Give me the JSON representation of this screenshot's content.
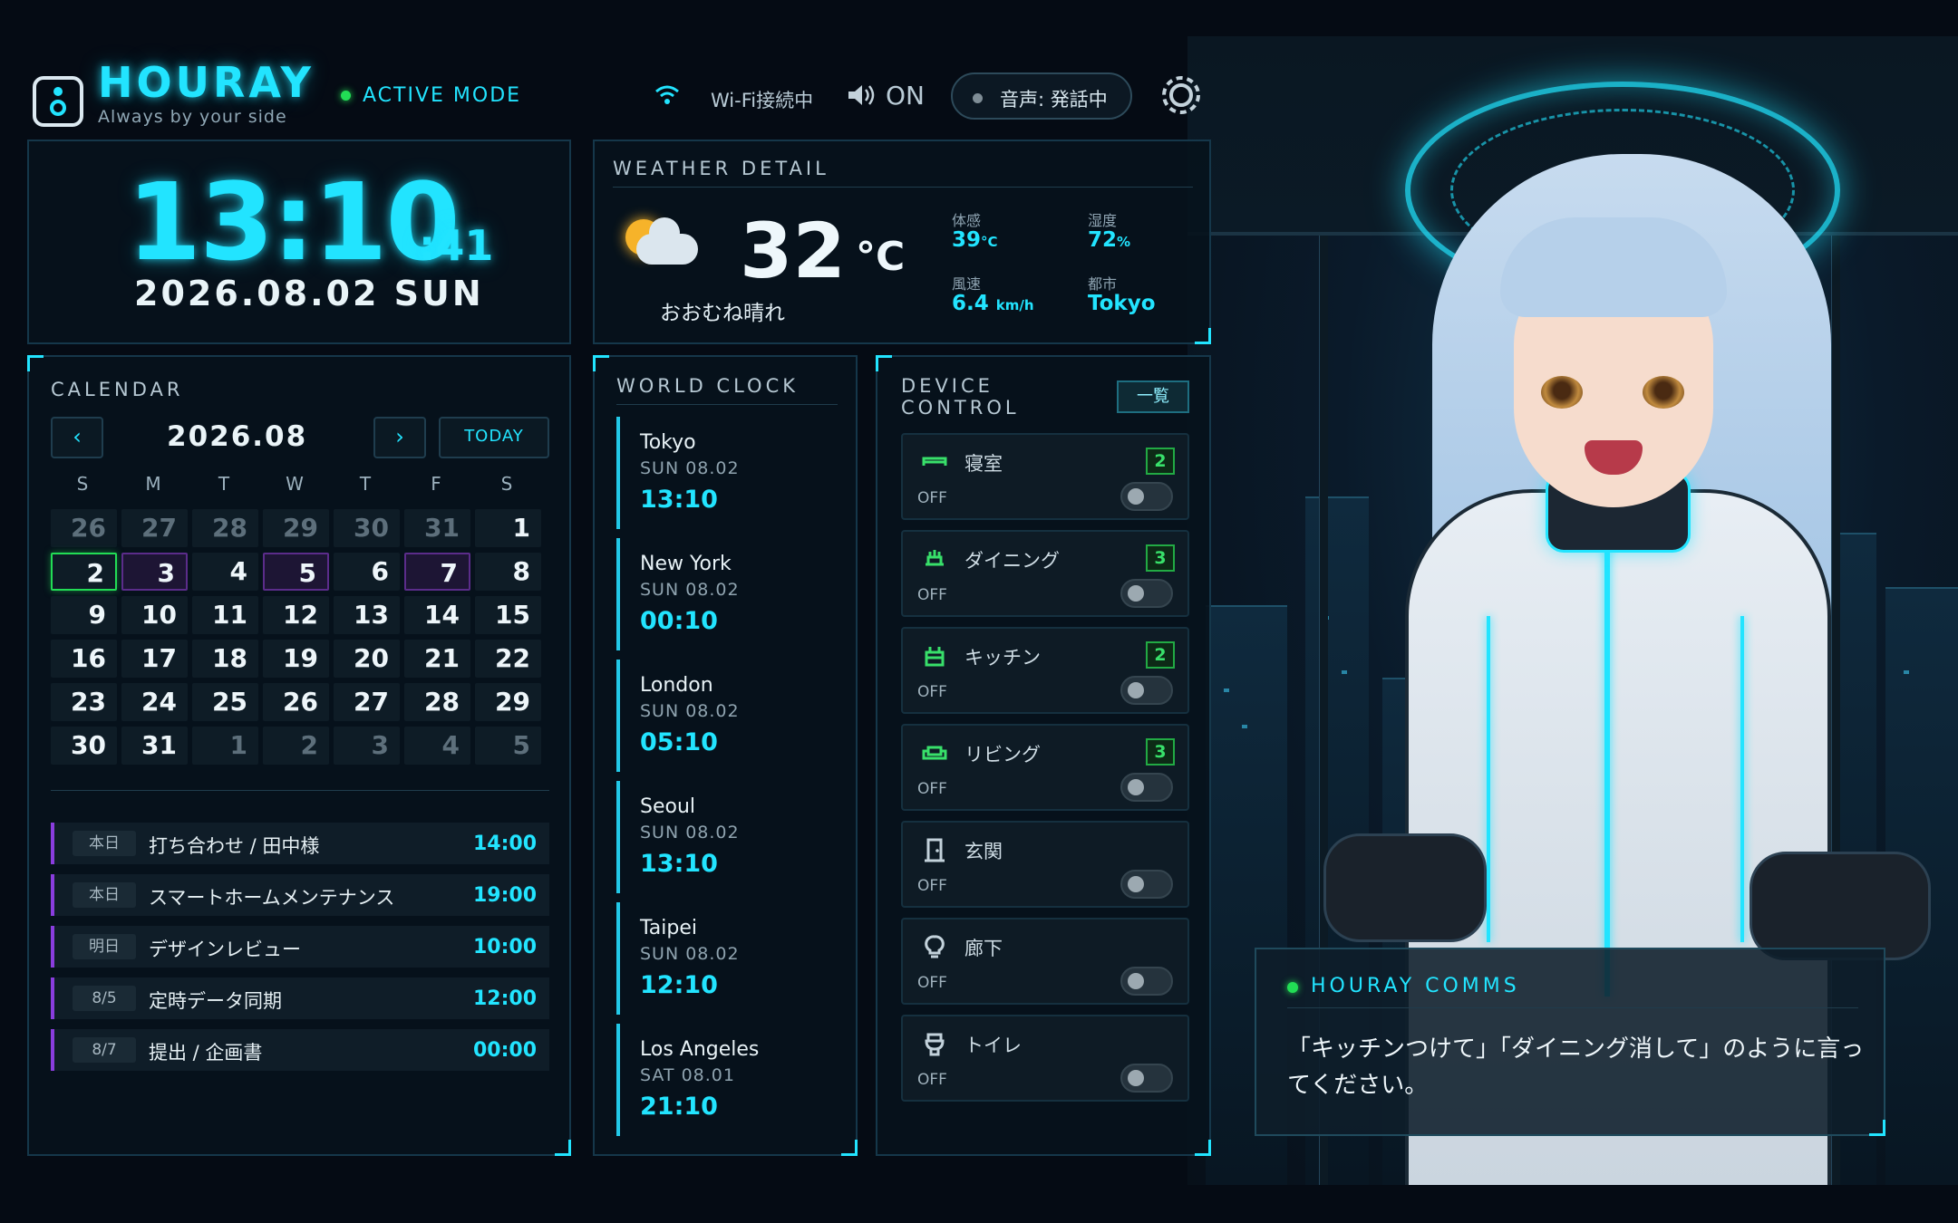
{
  "header": {
    "brand": "HOURAY",
    "tagline": "Always by your side",
    "mode": "ACTIVE MODE",
    "wifi": "Wi-Fi接続中",
    "sound": "ON",
    "voice": "音声: 発話中",
    "icons": [
      "logo-icon",
      "wifi-icon",
      "speaker-icon",
      "gear-icon"
    ]
  },
  "clock": {
    "time": "13:10",
    "seconds": ":41",
    "date": "2026.08.02 SUN"
  },
  "weather": {
    "title": "WEATHER DETAIL",
    "temp": "32",
    "unit": "°C",
    "condition": "おおむね晴れ",
    "feels_label": "体感",
    "feels_value": "39",
    "feels_unit": "°C",
    "humidity_label": "湿度",
    "humidity_value": "72",
    "humidity_unit": "%",
    "wind_label": "風速",
    "wind_value": "6.4",
    "wind_unit": "km/h",
    "city_label": "都市",
    "city_value": "Tokyo"
  },
  "calendar": {
    "title": "CALENDAR",
    "prev": "‹",
    "next": "›",
    "month": "2026.08",
    "today": "TODAY",
    "weekdays": [
      "S",
      "M",
      "T",
      "W",
      "T",
      "F",
      "S"
    ],
    "weeks": [
      [
        "26",
        "27",
        "28",
        "29",
        "30",
        "31",
        "1"
      ],
      [
        "2",
        "3",
        "4",
        "5",
        "6",
        "7",
        "8"
      ],
      [
        "9",
        "10",
        "11",
        "12",
        "13",
        "14",
        "15"
      ],
      [
        "16",
        "17",
        "18",
        "19",
        "20",
        "21",
        "22"
      ],
      [
        "23",
        "24",
        "25",
        "26",
        "27",
        "28",
        "29"
      ],
      [
        "30",
        "31",
        "1",
        "2",
        "3",
        "4",
        "5"
      ]
    ],
    "events": [
      {
        "tag": "本日",
        "title": "打ち合わせ / 田中様",
        "time": "14:00"
      },
      {
        "tag": "本日",
        "title": "スマートホームメンテナンス",
        "time": "19:00"
      },
      {
        "tag": "明日",
        "title": "デザインレビュー",
        "time": "10:00"
      },
      {
        "tag": "8/5",
        "title": "定時データ同期",
        "time": "12:00"
      },
      {
        "tag": "8/7",
        "title": "提出 / 企画書",
        "time": "00:00"
      }
    ]
  },
  "worldclock": {
    "title": "WORLD CLOCK",
    "cities": [
      {
        "city": "Tokyo",
        "date": "SUN 08.02",
        "time": "13:10"
      },
      {
        "city": "New York",
        "date": "SUN 08.02",
        "time": "00:10"
      },
      {
        "city": "London",
        "date": "SUN 08.02",
        "time": "05:10"
      },
      {
        "city": "Seoul",
        "date": "SUN 08.02",
        "time": "13:10"
      },
      {
        "city": "Taipei",
        "date": "SUN 08.02",
        "time": "12:10"
      },
      {
        "city": "Los Angeles",
        "date": "SAT 08.01",
        "time": "21:10"
      }
    ]
  },
  "devices": {
    "title_line1": "DEVICE",
    "title_line2": "CONTROL",
    "list_button": "一覧",
    "items": [
      {
        "name": "寝室",
        "state": "OFF",
        "count": "2",
        "icon": "bed-icon"
      },
      {
        "name": "ダイニング",
        "state": "OFF",
        "count": "3",
        "icon": "dining-icon"
      },
      {
        "name": "キッチン",
        "state": "OFF",
        "count": "2",
        "icon": "kitchen-icon"
      },
      {
        "name": "リビング",
        "state": "OFF",
        "count": "3",
        "icon": "sofa-icon"
      },
      {
        "name": "玄関",
        "state": "OFF",
        "count": "",
        "icon": "door-icon"
      },
      {
        "name": "廊下",
        "state": "OFF",
        "count": "",
        "icon": "bulb-icon"
      },
      {
        "name": "トイレ",
        "state": "OFF",
        "count": "",
        "icon": "toilet-icon"
      }
    ]
  },
  "comms": {
    "title": "HOURAY COMMS",
    "message": "「キッチンつけて」「ダイニング消して」のように言ってください。"
  },
  "colors": {
    "accent": "#22e4ff",
    "active": "#22dd55",
    "event": "#8a3dde",
    "background": "#050b14"
  }
}
